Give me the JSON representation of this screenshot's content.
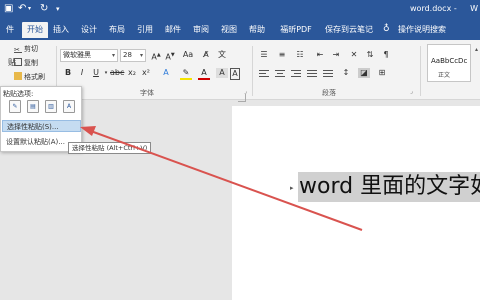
{
  "title_bar": {
    "title": "word.docx -",
    "right_text": "W"
  },
  "tabs": [
    {
      "label": "件"
    },
    {
      "label": "开始",
      "active": true
    },
    {
      "label": "插入"
    },
    {
      "label": "设计"
    },
    {
      "label": "布局"
    },
    {
      "label": "引用"
    },
    {
      "label": "邮件"
    },
    {
      "label": "审阅"
    },
    {
      "label": "视图"
    },
    {
      "label": "帮助"
    },
    {
      "label": "福昕PDF"
    },
    {
      "label": "保存到云笔记"
    },
    {
      "label": "操作说明搜索"
    }
  ],
  "clipboard": {
    "cut": "剪切",
    "copy": "复制",
    "format_painter": "格式刷",
    "paste_short": "贴"
  },
  "font_group": {
    "font_name": "微软雅黑",
    "font_size": "28",
    "label": "字体"
  },
  "paragraph_group": {
    "label": "段落"
  },
  "styles": {
    "sample": "AaBbCcDc",
    "name": "正文"
  },
  "paste_menu": {
    "header": "粘贴选项:",
    "items": [
      {
        "label": "选择性粘贴(S)...",
        "highlighted": true
      },
      {
        "label": "设置默认粘贴(A)..."
      }
    ]
  },
  "tooltip": {
    "text": "选择性粘贴 (Alt+Ctrl+V)"
  },
  "document": {
    "text": "word 里面的文字如"
  },
  "colors": {
    "ribbon_blue": "#2b579a",
    "arrow_red": "#d9534f",
    "selection_gray": "#d0d0d0"
  }
}
